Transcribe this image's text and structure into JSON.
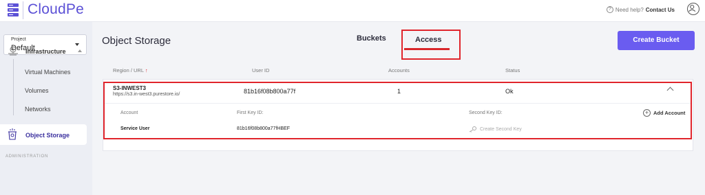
{
  "brand": {
    "name": "CloudPe",
    "accent": "#5b50d6"
  },
  "topbar": {
    "help_prefix": "Need help?",
    "help_link": "Contact Us"
  },
  "sidebar": {
    "project_label": "Project",
    "project_value": "Default",
    "infrastructure": "Infrastructure",
    "sub_items": [
      "Virtual Machines",
      "Volumes",
      "Networks"
    ],
    "object_storage": "Object Storage",
    "administration": "ADMINISTRATION"
  },
  "main": {
    "title": "Object Storage",
    "tabs": {
      "buckets": "Buckets",
      "access": "Access"
    },
    "create_button": "Create Bucket",
    "columns": {
      "region": "Region / URL",
      "region_sort": "↑",
      "user_id": "User ID",
      "accounts": "Accounts",
      "status": "Status"
    },
    "row": {
      "region_name": "S3-INWEST3",
      "region_url": "https://s3.in-west3.purestore.io/",
      "user_id": "81b16f08b800a77f",
      "accounts": "1",
      "status": "Ok"
    },
    "details": {
      "head_account": "Account",
      "head_first_key": "First Key ID:",
      "head_second_key": "Second Key ID:",
      "add_account": "Add Account",
      "account_value": "Service User",
      "first_key_value": "81b16f08b800a77fHBEF",
      "create_second_key": "Create Second Key"
    }
  },
  "colors": {
    "primary_button": "#6a5cf0",
    "highlight_box": "#e0242b",
    "tab_underline": "#d9262a"
  }
}
